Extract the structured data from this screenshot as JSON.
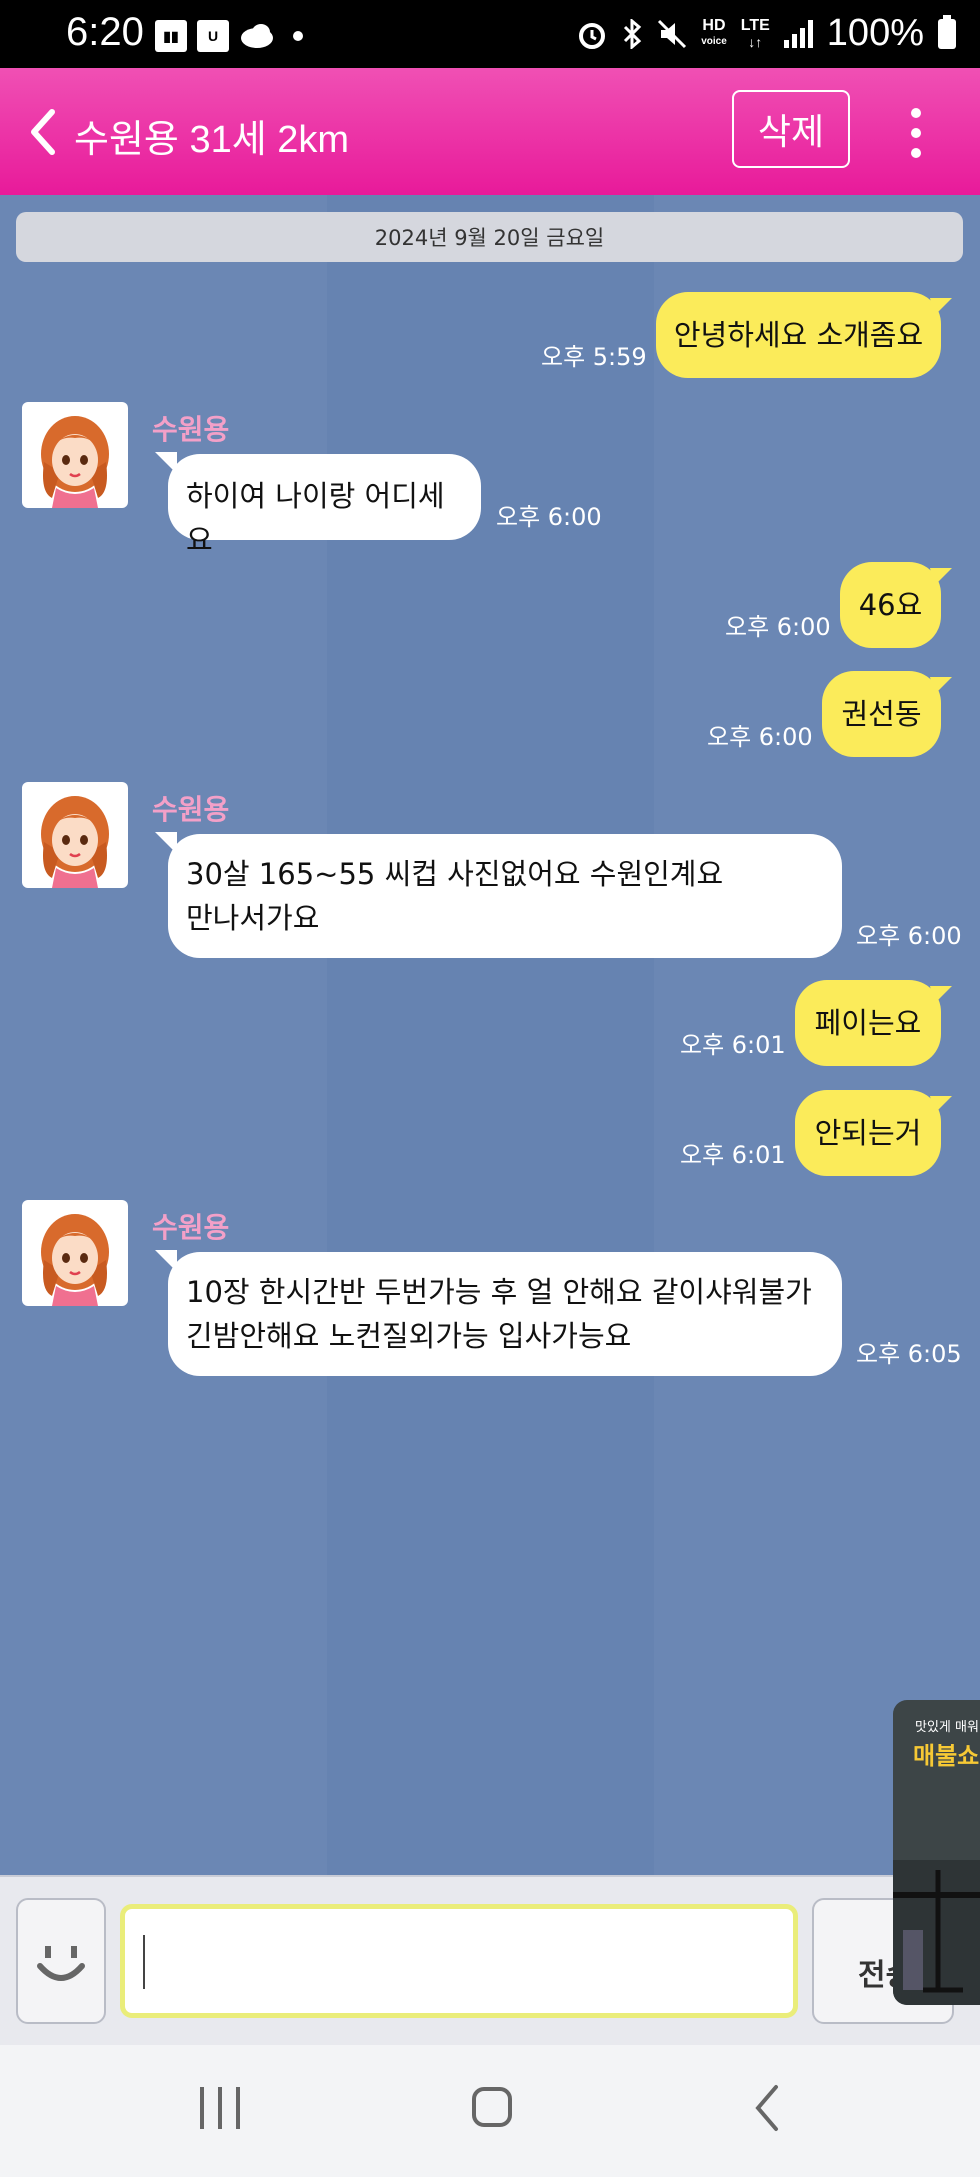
{
  "status_bar": {
    "time": "6:20",
    "battery": "100%",
    "network": "LTE",
    "hd_label": "HD",
    "voice_label": "voice"
  },
  "header": {
    "title": "수원용 31세 2km",
    "delete_label": "삭제"
  },
  "chat": {
    "date_divider": "2024년 9월 20일 금요일",
    "messages": [
      {
        "direction": "out",
        "text": "안녕하세요 소개좀요",
        "time": "오후 5:59"
      },
      {
        "direction": "in",
        "sender": "수원용",
        "text": "하이여 나이랑 어디세요",
        "time": "오후 6:00"
      },
      {
        "direction": "out",
        "text": "46요",
        "time": "오후 6:00"
      },
      {
        "direction": "out",
        "text": "권선동",
        "time": "오후 6:00"
      },
      {
        "direction": "in",
        "sender": "수원용",
        "line1": "30살 165~55 씨컵  사진없어요  수원인계요",
        "line2": "만나서가요",
        "time": "오후 6:00"
      },
      {
        "direction": "out",
        "text": "페이는요",
        "time": "오후 6:01"
      },
      {
        "direction": "out",
        "text": "안되는거",
        "time": "오후 6:01"
      },
      {
        "direction": "in",
        "sender": "수원용",
        "line1": "10장 한시간반 두번가능 후 얼 안해요 같이샤워불가",
        "line2": "긴밤안해요 노컨질외가능 입사가능요",
        "time": "오후 6:05"
      }
    ]
  },
  "input": {
    "value": "",
    "send_label": "전송"
  },
  "floating_ad": {
    "small_text": "맛있게 매워",
    "title": "매불쇼"
  },
  "colors": {
    "header": "#e81a9a",
    "chat_background": "#6b87b4",
    "outgoing_bubble": "#fbeb5a",
    "incoming_bubble": "#ffffff",
    "sender_name": "#f3a0c8"
  }
}
